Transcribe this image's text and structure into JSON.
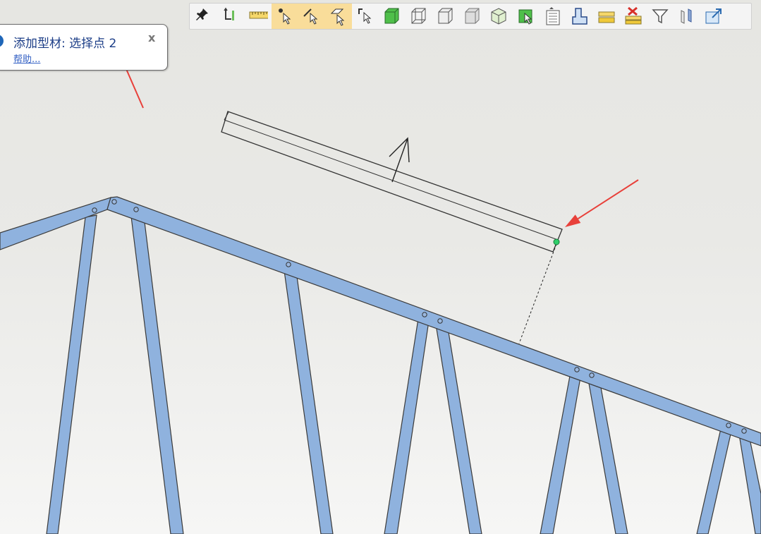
{
  "toolbar": {
    "buttons": [
      {
        "name": "pin-icon",
        "active": false
      },
      {
        "name": "rotate-axis-icon",
        "active": false
      },
      {
        "name": "ruler-icon",
        "active": false
      },
      {
        "name": "select-point-icon",
        "active": true
      },
      {
        "name": "select-edge-icon",
        "active": true
      },
      {
        "name": "select-face-icon",
        "active": true
      },
      {
        "name": "select-mode-icon",
        "active": false
      },
      {
        "name": "view-shaded-icon",
        "active": false
      },
      {
        "name": "view-wireframe-icon",
        "active": false
      },
      {
        "name": "view-hidden-line-icon",
        "active": false
      },
      {
        "name": "view-transparent-icon",
        "active": false
      },
      {
        "name": "view-cube-icon",
        "active": false
      },
      {
        "name": "select-component-icon",
        "active": false
      },
      {
        "name": "document-list-icon",
        "active": false
      },
      {
        "name": "profile-shape-icon",
        "active": false
      },
      {
        "name": "layer-icon",
        "active": false
      },
      {
        "name": "delete-layer-icon",
        "active": false
      },
      {
        "name": "filter-icon",
        "active": false
      },
      {
        "name": "section-icon",
        "active": false
      },
      {
        "name": "export-view-icon",
        "active": false
      }
    ]
  },
  "hint": {
    "title": "添加型材: 选择点 2",
    "help_link": "帮助...",
    "close": "x"
  },
  "colors": {
    "beam_fill": "#8fb2de",
    "beam_stroke": "#3a3a3a",
    "annotation_arrow": "#e8403a",
    "snap_point": "#2fcf6a",
    "active_tool": "#f9dd9a",
    "hint_text": "#1b3d87"
  }
}
